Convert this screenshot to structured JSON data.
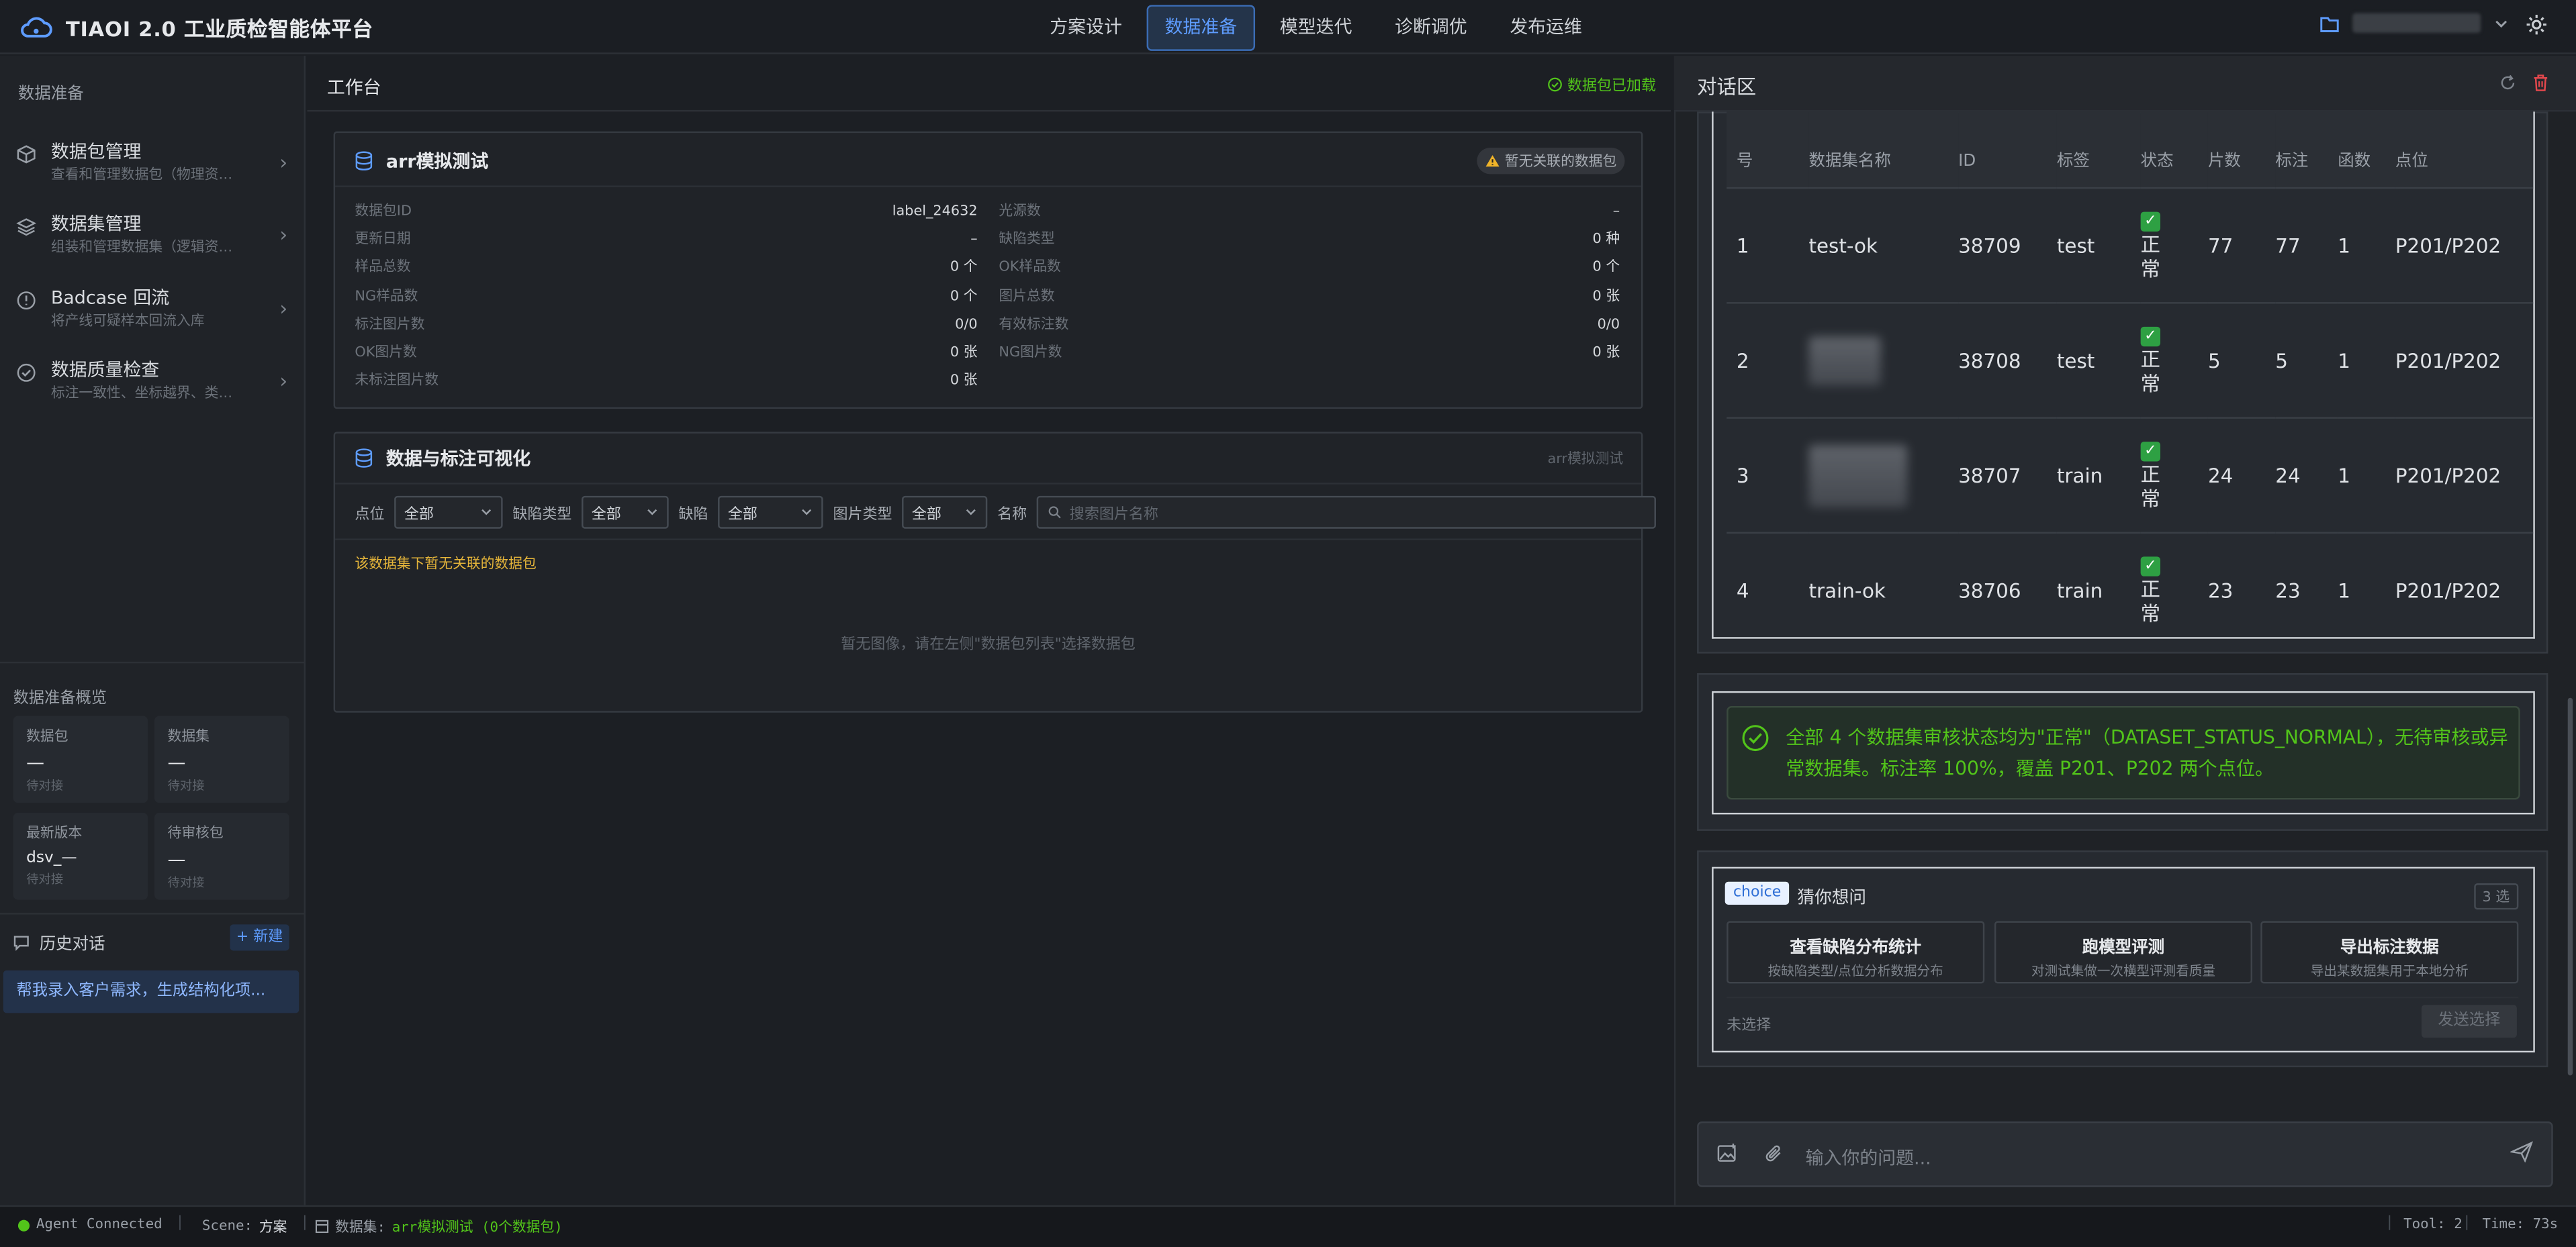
{
  "app": {
    "title": "TIAOI 2.0 工业质检智能体平台"
  },
  "nav": {
    "tabs": [
      "方案设计",
      "数据准备",
      "模型迭代",
      "诊断调优",
      "发布运维"
    ],
    "active": "数据准备"
  },
  "sidebar": {
    "heading": "数据准备",
    "items": [
      {
        "title": "数据包管理",
        "desc": "查看和管理数据包（物理资产…"
      },
      {
        "title": "数据集管理",
        "desc": "组装和管理数据集（逻辑资产…"
      },
      {
        "title": "Badcase 回流",
        "desc": "将产线可疑样本回流入库"
      },
      {
        "title": "数据质量检查",
        "desc": "标注一致性、坐标越界、类别…"
      }
    ],
    "overview": {
      "title": "数据准备概览",
      "cards": [
        {
          "label": "数据包",
          "value": "—",
          "sub": "待对接"
        },
        {
          "label": "数据集",
          "value": "—",
          "sub": "待对接"
        },
        {
          "label": "最新版本",
          "value": "dsv_—",
          "sub": "待对接"
        },
        {
          "label": "待审核包",
          "value": "—",
          "sub": "待对接"
        }
      ]
    },
    "history": {
      "title": "历史对话",
      "new_label": "+ 新建",
      "items": [
        "帮我录入客户需求，生成结构化项..."
      ]
    }
  },
  "workbench": {
    "title": "工作台",
    "loaded": "数据包已加载",
    "package": {
      "name": "arr模拟测试",
      "badge": "暂无关联的数据包",
      "left": [
        {
          "k": "数据包ID",
          "v": "label_24632"
        },
        {
          "k": "更新日期",
          "v": "–"
        },
        {
          "k": "样品总数",
          "v": "0 个"
        },
        {
          "k": "NG样品数",
          "v": "0 个"
        },
        {
          "k": "标注图片数",
          "v": "0/0"
        },
        {
          "k": "OK图片数",
          "v": "0 张"
        },
        {
          "k": "未标注图片数",
          "v": "0 张"
        }
      ],
      "right": [
        {
          "k": "光源数",
          "v": "–"
        },
        {
          "k": "缺陷类型",
          "v": "0 种"
        },
        {
          "k": "OK样品数",
          "v": "0 个"
        },
        {
          "k": "图片总数",
          "v": "0 张"
        },
        {
          "k": "有效标注数",
          "v": "0/0"
        },
        {
          "k": "NG图片数",
          "v": "0 张"
        }
      ]
    },
    "viz": {
      "title": "数据与标注可视化",
      "tag": "arr模拟测试",
      "filters": [
        {
          "label": "点位",
          "value": "全部"
        },
        {
          "label": "缺陷类型",
          "value": "全部"
        },
        {
          "label": "缺陷",
          "value": "全部"
        },
        {
          "label": "图片类型",
          "value": "全部"
        }
      ],
      "name_label": "名称",
      "search_placeholder": "搜索图片名称",
      "notice": "该数据集下暂无关联的数据包",
      "empty": "暂无图像，请在左侧\"数据包列表\"选择数据包"
    }
  },
  "chat": {
    "title": "对话区",
    "table": {
      "headers": [
        "号",
        "数据集名称",
        "ID",
        "标签",
        "状态",
        "片数",
        "标注",
        "函数",
        "点位"
      ],
      "rows": [
        {
          "no": "1",
          "name": "test-ok",
          "id": "38709",
          "tag": "test",
          "status": "正常",
          "imgs": "77",
          "labels": "77",
          "funcs": "1",
          "points": "P201/P202"
        },
        {
          "no": "2",
          "name": "",
          "id": "38708",
          "tag": "test",
          "status": "正常",
          "imgs": "5",
          "labels": "5",
          "funcs": "1",
          "points": "P201/P202"
        },
        {
          "no": "3",
          "name": "",
          "id": "38707",
          "tag": "train",
          "status": "正常",
          "imgs": "24",
          "labels": "24",
          "funcs": "1",
          "points": "P201/P202"
        },
        {
          "no": "4",
          "name": "train-ok",
          "id": "38706",
          "tag": "train",
          "status": "正常",
          "imgs": "23",
          "labels": "23",
          "funcs": "1",
          "points": "P201/P202"
        }
      ]
    },
    "ok_message": "全部 4 个数据集审核状态均为\"正常\"（DATASET_STATUS_NORMAL），无待审核或异常数据集。标注率 100%，覆盖 P201、P202 两个点位。",
    "choice": {
      "tag": "choice",
      "question": "猜你想问",
      "count": "3 选",
      "options": [
        {
          "title": "查看缺陷分布统计",
          "desc": "按缺陷类型/点位分析数据分布"
        },
        {
          "title": "跑模型评测",
          "desc": "对测试集做一次横型评测看质量"
        },
        {
          "title": "导出标注数据",
          "desc": "导出某数据集用于本地分析"
        }
      ],
      "unselected": "未选择",
      "send_label": "发送选择"
    },
    "input_placeholder": "输入你的问题..."
  },
  "statusbar": {
    "agent": "Agent Connected",
    "scene_label": "Scene:",
    "scene_value": "方案",
    "dataset_label": "数据集:",
    "dataset_value": "arr模拟测试 (0个数据包)",
    "tool": "Tool: 2",
    "time": "Time: 73s"
  },
  "colors": {
    "accent": "#5e9cff",
    "success": "#52c41a",
    "warning": "#f0b429",
    "danger": "#e5484d"
  }
}
